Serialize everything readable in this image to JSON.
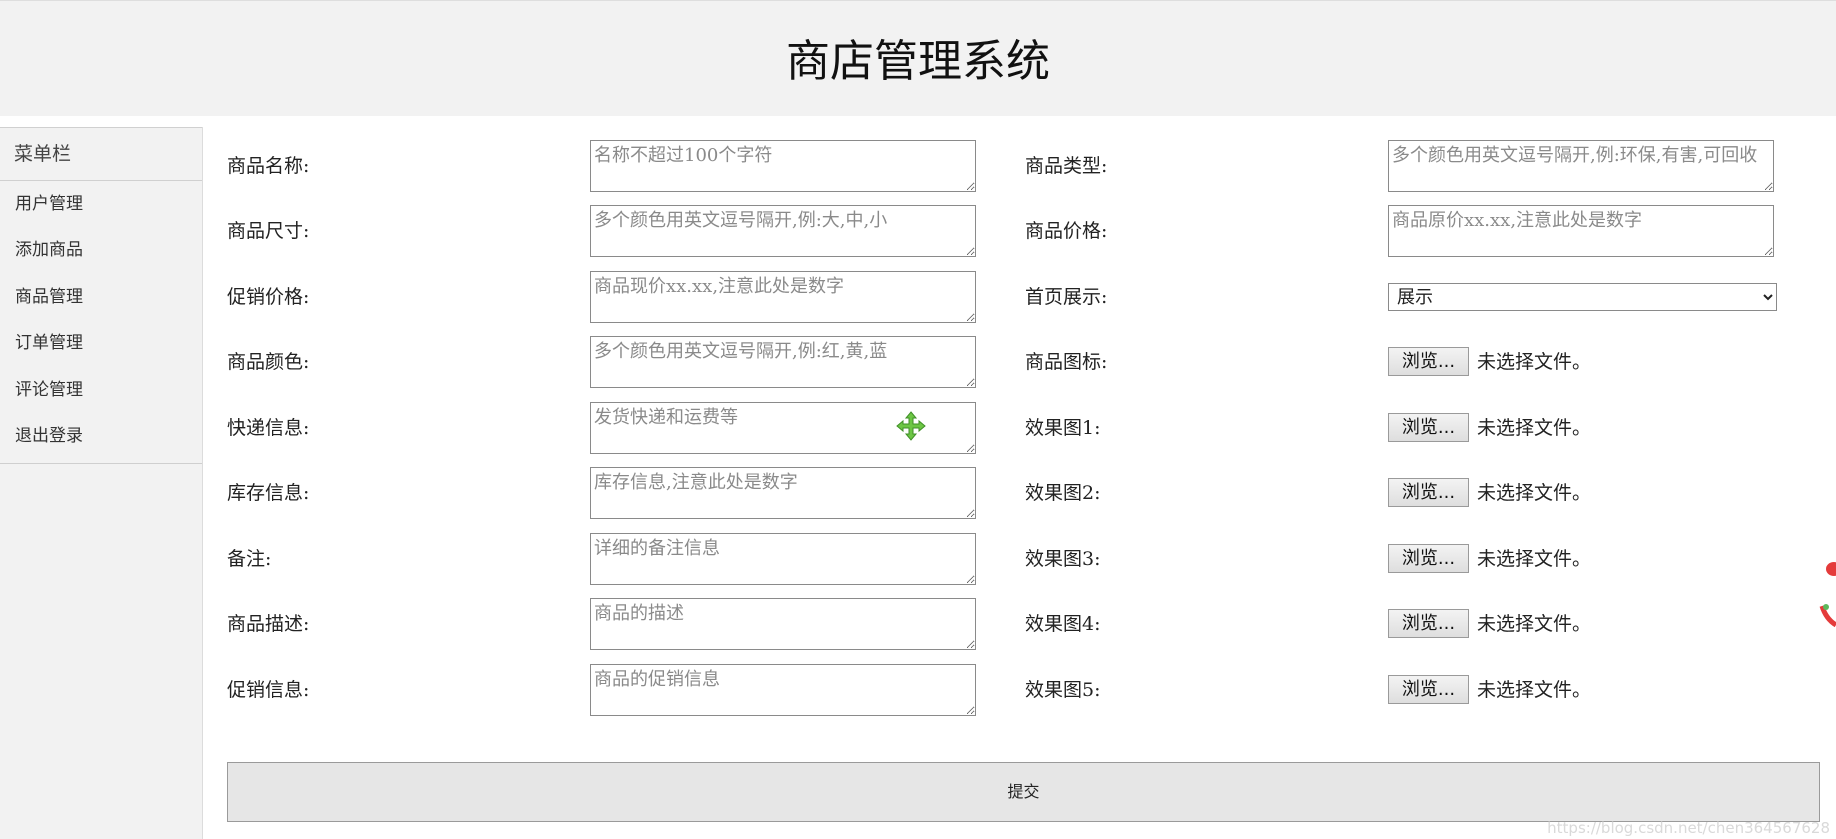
{
  "header": {
    "title": "商店管理系统"
  },
  "sidebar": {
    "title": "菜单栏",
    "items": [
      {
        "label": "用户管理"
      },
      {
        "label": "添加商品"
      },
      {
        "label": "商品管理"
      },
      {
        "label": "订单管理"
      },
      {
        "label": "评论管理"
      },
      {
        "label": "退出登录"
      }
    ]
  },
  "form": {
    "left": [
      {
        "label": "商品名称:",
        "placeholder": "名称不超过100个字符"
      },
      {
        "label": "商品尺寸:",
        "placeholder": "多个颜色用英文逗号隔开,例:大,中,小"
      },
      {
        "label": "促销价格:",
        "placeholder": "商品现价xx.xx,注意此处是数字"
      },
      {
        "label": "商品颜色:",
        "placeholder": "多个颜色用英文逗号隔开,例:红,黄,蓝"
      },
      {
        "label": "快递信息:",
        "placeholder": "发货快递和运费等"
      },
      {
        "label": "库存信息:",
        "placeholder": "库存信息,注意此处是数字"
      },
      {
        "label": "备注:",
        "placeholder": "详细的备注信息"
      },
      {
        "label": "商品描述:",
        "placeholder": "商品的描述"
      },
      {
        "label": "促销信息:",
        "placeholder": "商品的促销信息"
      }
    ],
    "right": {
      "type": {
        "label": "商品类型:",
        "placeholder": "多个颜色用英文逗号隔开,例:环保,有害,可回收"
      },
      "price": {
        "label": "商品价格:",
        "placeholder": "商品原价xx.xx,注意此处是数字"
      },
      "homepage": {
        "label": "首页展示:",
        "selected": "展示"
      },
      "files": [
        {
          "label": "商品图标:",
          "button": "浏览...",
          "status": "未选择文件。"
        },
        {
          "label": "效果图1:",
          "button": "浏览...",
          "status": "未选择文件。"
        },
        {
          "label": "效果图2:",
          "button": "浏览...",
          "status": "未选择文件。"
        },
        {
          "label": "效果图3:",
          "button": "浏览...",
          "status": "未选择文件。"
        },
        {
          "label": "效果图4:",
          "button": "浏览...",
          "status": "未选择文件。"
        },
        {
          "label": "效果图5:",
          "button": "浏览...",
          "status": "未选择文件。"
        }
      ]
    },
    "submit_label": "提交"
  },
  "watermark": "https://blog.csdn.net/chen364567628",
  "colors": {
    "header_bg": "#f2f2f2",
    "sidebar_bg": "#f2f2f2",
    "submit_bg": "#e6e6e6",
    "move_icon": "#6cc644"
  }
}
